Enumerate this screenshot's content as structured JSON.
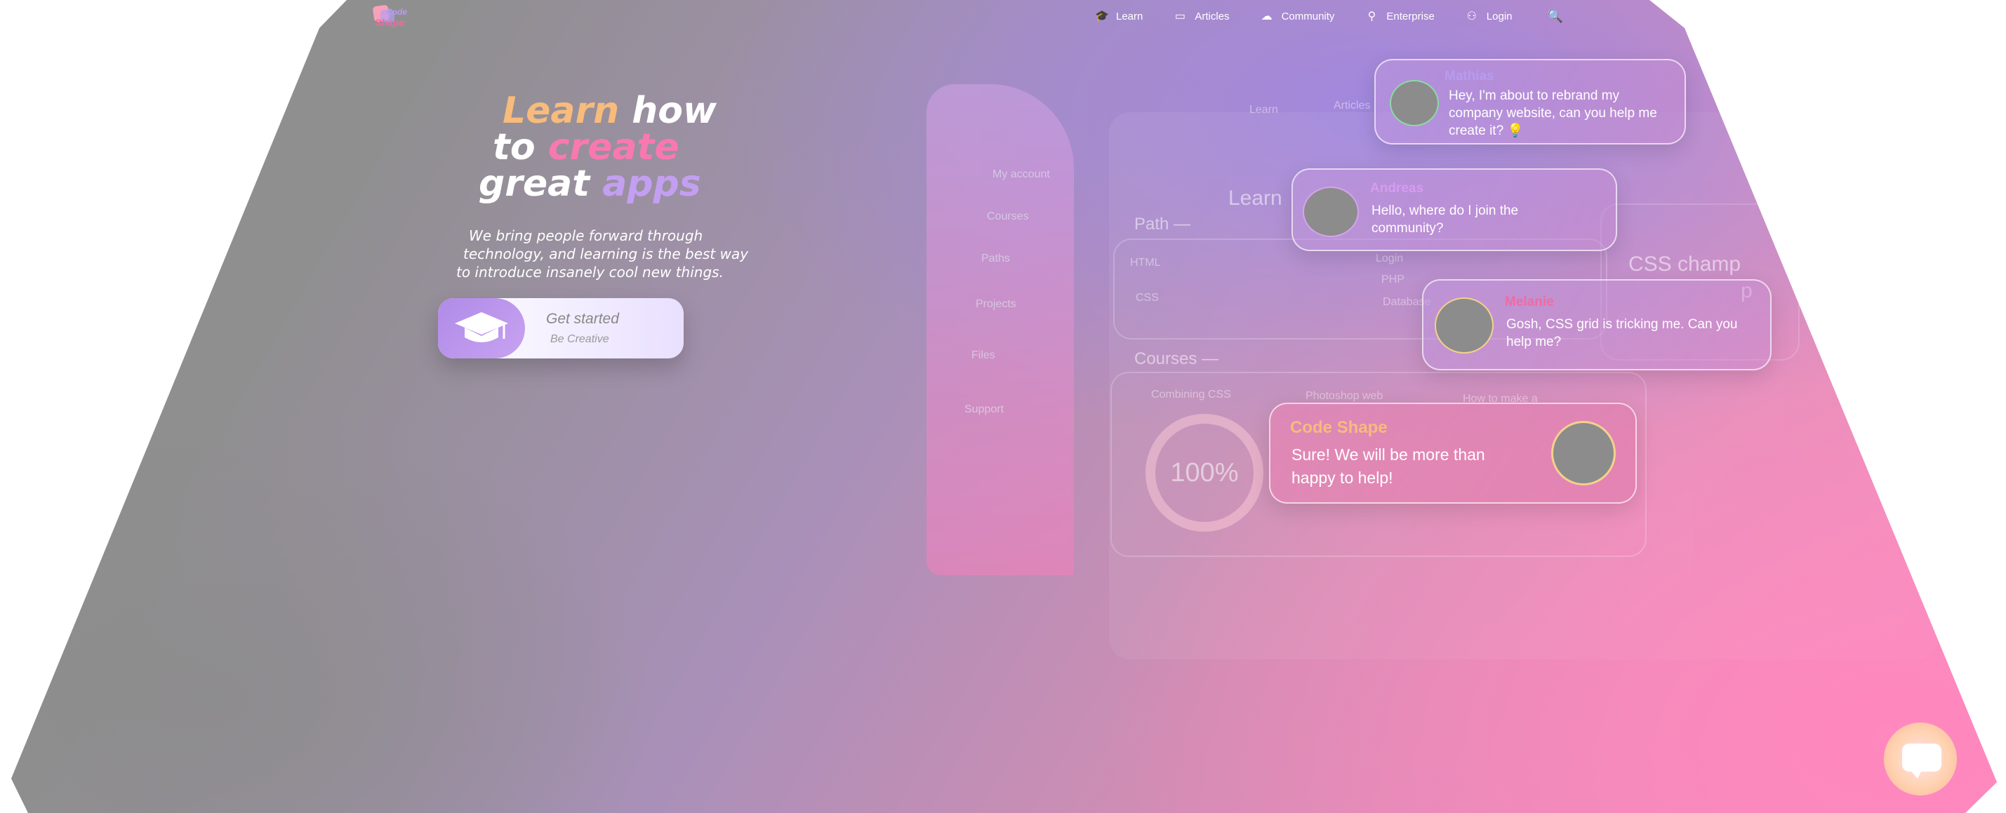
{
  "logo": {
    "line1": "Code",
    "line2": "Shape"
  },
  "nav": {
    "items": [
      {
        "label": "Learn",
        "icon": "graduation-cap-icon",
        "glyph": "🎓"
      },
      {
        "label": "Articles",
        "icon": "document-icon",
        "glyph": "▭"
      },
      {
        "label": "Community",
        "icon": "people-icon",
        "glyph": "☁"
      },
      {
        "label": "Enterprise",
        "icon": "pin-icon",
        "glyph": "⚲"
      },
      {
        "label": "Login",
        "icon": "user-icon",
        "glyph": "⚇"
      }
    ],
    "search_glyph": "🔍"
  },
  "hero": {
    "title_learn": "Learn",
    "title_how": " how",
    "title_to": "to",
    "title_create": "create",
    "title_great": "great",
    "title_apps": "apps",
    "subtitle_lines": [
      "We bring people forward through",
      "technology, and learning is the best way",
      "to introduce insanely cool new things."
    ],
    "cta_label": "Get started",
    "cta_sublabel": "Be Creative"
  },
  "mock": {
    "sidebar": [
      "My account",
      "Courses",
      "Paths",
      "Projects",
      "Files",
      "Support"
    ],
    "nav": [
      "Learn",
      "Articles"
    ],
    "learn_heading": "Learn",
    "path_heading": "Path —",
    "courses_heading": "Courses —",
    "path_nodes": [
      "HTML",
      "CSS",
      "Login",
      "PHP",
      "Database"
    ],
    "course_titles": [
      "Combining CSS",
      "Photoshop web",
      "How to make a"
    ],
    "progress": "100%",
    "badge": "CSS champ",
    "badge_partial": "p"
  },
  "chats": [
    {
      "name": "Mathias",
      "message": "Hey, I'm about to rebrand my company website, can you help me create it? 💡",
      "name_color": "#b69cf0"
    },
    {
      "name": "Andreas",
      "message": "Hello, where do I join the community?",
      "name_color": "#d69cf0"
    },
    {
      "name": "Melanie",
      "message": "Gosh, CSS grid is tricking me. Can you help me?",
      "name_color": "#f16aa2"
    },
    {
      "name": "Code Shape",
      "message": "Sure! We will be more than happy to help!",
      "name_color": "#f7bb7b"
    }
  ]
}
